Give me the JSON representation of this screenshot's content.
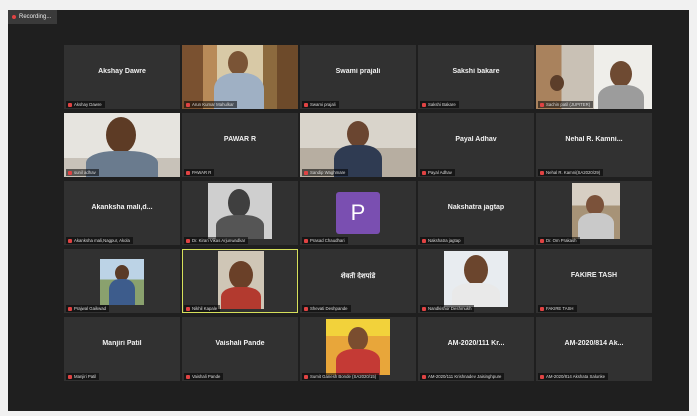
{
  "recording": {
    "label": "Recording..."
  },
  "tiles": [
    {
      "id": "t1",
      "name": "Akshay Dawre",
      "caption": "Akshay Dawre"
    },
    {
      "id": "t2",
      "name": "",
      "caption": "Arun Kumar Mahulkar"
    },
    {
      "id": "t3",
      "name": "Swami prajali",
      "caption": "Swami prajali"
    },
    {
      "id": "t4",
      "name": "Sakshi bakare",
      "caption": "Sakshi Bakare"
    },
    {
      "id": "t5",
      "name": "",
      "caption": "Sachin patil (JUPITER)"
    },
    {
      "id": "t6",
      "name": "",
      "caption": "sunil adhav"
    },
    {
      "id": "t7",
      "name": "PAWAR R",
      "caption": "PAWAR R"
    },
    {
      "id": "t8",
      "name": "",
      "caption": "Sandip Waghmare"
    },
    {
      "id": "t9",
      "name": "Payal Adhav",
      "caption": "Payal Adhav"
    },
    {
      "id": "t10",
      "name": "Nehal  R. Kamni...",
      "caption": "Nehal R. Kamni(SA2020/29)"
    },
    {
      "id": "t11",
      "name": "Akanksha  mali,d...",
      "caption": "Akanksha mali,Nagpur, Akola"
    },
    {
      "id": "t12",
      "name": "",
      "caption": "Dr. Kiran Vikas Arjunwadkar"
    },
    {
      "id": "t13",
      "name": "",
      "caption": "Prasad Chaudhari"
    },
    {
      "id": "t14",
      "name": "Nakshatra  jagtap",
      "caption": "Nakshatra jagtap"
    },
    {
      "id": "t15",
      "name": "",
      "caption": "Dr. Om Prakash"
    },
    {
      "id": "t16",
      "name": "",
      "caption": "Prajwal Gaikwad"
    },
    {
      "id": "t17",
      "name": "",
      "caption": "Nikhil Kapale"
    },
    {
      "id": "t18",
      "name": "शेवती देशपांडे",
      "caption": "Shevati Deshpande"
    },
    {
      "id": "t19",
      "name": "",
      "caption": "Nandkishor Deshmukh"
    },
    {
      "id": "t20",
      "name": "FAKIRE TASH",
      "caption": "FAKIRE TASH"
    },
    {
      "id": "t21",
      "name": "Manjiri Patil",
      "caption": "Manjiri Patil"
    },
    {
      "id": "t22",
      "name": "Vaishali Pande",
      "caption": "Vaishali Pande"
    },
    {
      "id": "t23",
      "name": "",
      "caption": "Sumit Ganesh Bonde (SA2020/15)"
    },
    {
      "id": "t24",
      "name": "AM-2020/111 Kr...",
      "caption": "AM-2020/111 Krishnadev Jaisinghpure"
    },
    {
      "id": "t25",
      "name": "AM-2020/814 Ak...",
      "caption": "AM-2020/814 Akshata Salunke"
    }
  ],
  "avatar": {
    "letter": "P",
    "color": "#7a4fb1"
  }
}
